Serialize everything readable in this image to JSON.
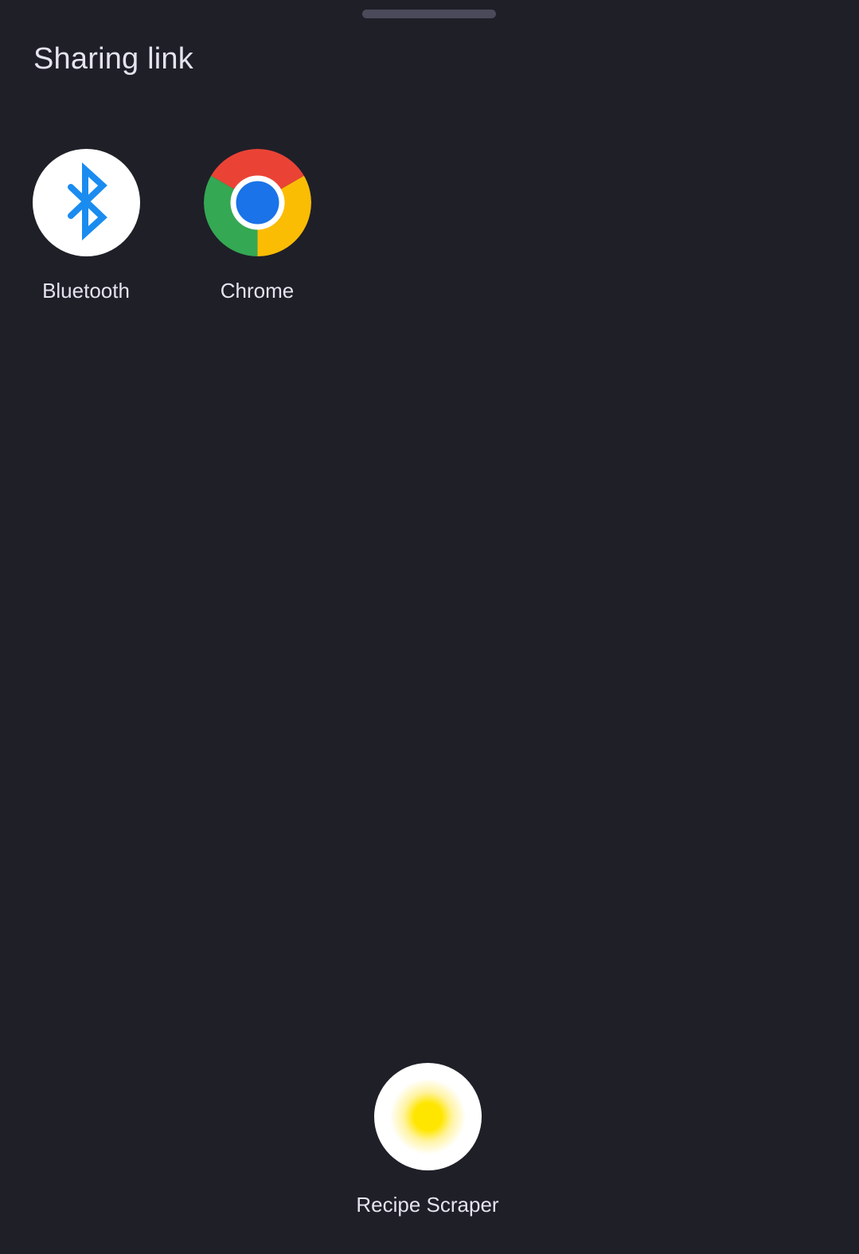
{
  "sheet": {
    "title": "Sharing link"
  },
  "targets": [
    {
      "label": "Bluetooth",
      "icon": "bluetooth-icon"
    },
    {
      "label": "Chrome",
      "icon": "chrome-icon"
    }
  ],
  "pinned": {
    "label": "Recipe Scraper",
    "icon": "recipe-scraper-icon"
  },
  "colors": {
    "background": "#1f1f28",
    "bluetooth_blue": "#1a8cf0",
    "chrome_red": "#ea4335",
    "chrome_yellow": "#fbbc04",
    "chrome_green": "#34a853",
    "chrome_blue": "#1a73e8",
    "recipe_yellow": "#ffe600"
  }
}
